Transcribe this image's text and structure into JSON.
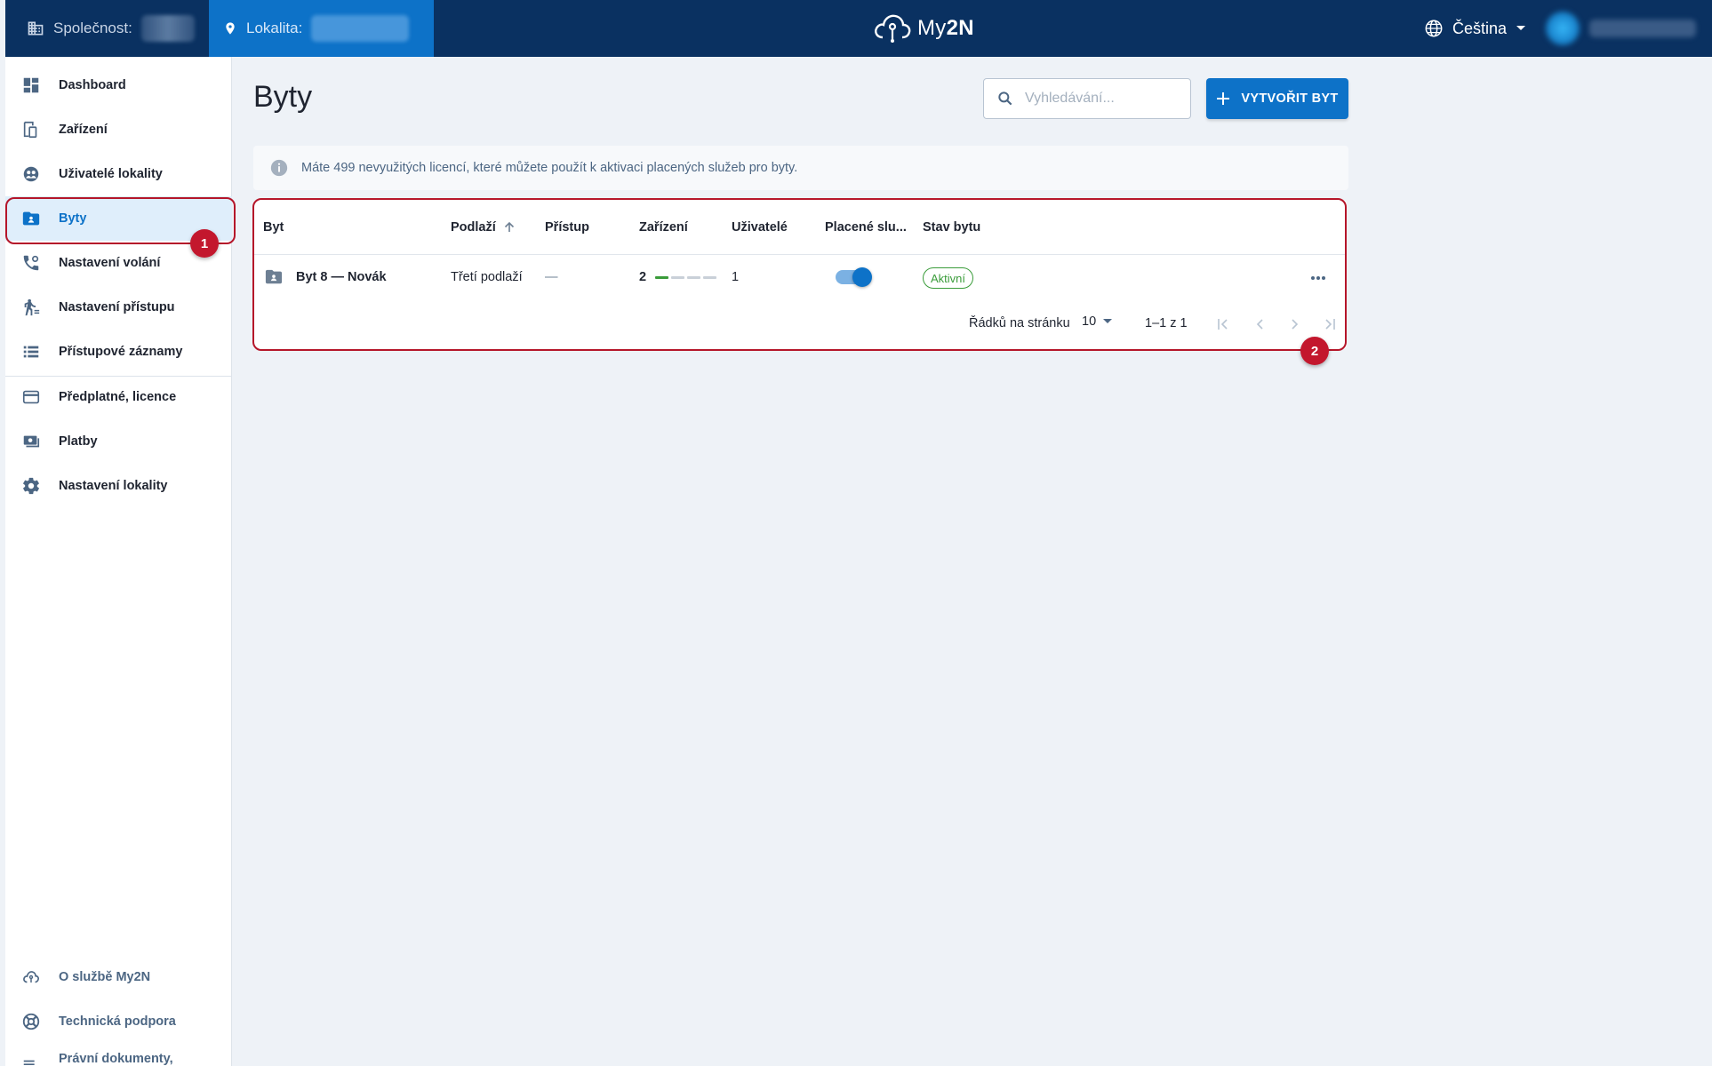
{
  "topbar": {
    "company_label": "Společnost:",
    "location_label": "Lokalita:",
    "logo_prefix": "My",
    "logo_suffix": "2N",
    "language": "Čeština"
  },
  "sidebar": {
    "items": [
      {
        "label": "Dashboard"
      },
      {
        "label": "Zařízení"
      },
      {
        "label": "Uživatelé lokality"
      },
      {
        "label": "Byty"
      },
      {
        "label": "Nastavení volání"
      },
      {
        "label": "Nastavení přístupu"
      },
      {
        "label": "Přístupové záznamy"
      },
      {
        "label": "Předplatné, licence"
      },
      {
        "label": "Platby"
      },
      {
        "label": "Nastavení lokality"
      }
    ],
    "footer": [
      {
        "label": "O službě My2N"
      },
      {
        "label": "Technická podpora"
      },
      {
        "label": "Právní dokumenty, soukromí"
      }
    ]
  },
  "main": {
    "title": "Byty",
    "search_placeholder": "Vyhledávání...",
    "create_button": "VYTVOŘIT BYT",
    "info": "Máte 499 nevyužitých licencí, které můžete použít k aktivaci placených služeb pro byty."
  },
  "table": {
    "headers": [
      "Byt",
      "Podlaží",
      "Přístup",
      "Zařízení",
      "Uživatelé",
      "Placené slu...",
      "Stav bytu"
    ],
    "rows": [
      {
        "name": "Byt 8 — Novák",
        "floor": "Třetí podlaží",
        "access": "—",
        "devices": "2",
        "users": "1",
        "paid_services": true,
        "status": "Aktivní"
      }
    ],
    "pagination": {
      "rows_per_page_label": "Řádků na stránku",
      "rows_per_page": "10",
      "range": "1–1 z 1"
    }
  },
  "annotations": [
    "1",
    "2"
  ],
  "colors": {
    "topbar": "#0a3161",
    "accent": "#0d72c8",
    "annotation": "#b5162a",
    "active_status": "#3a9c3a"
  }
}
